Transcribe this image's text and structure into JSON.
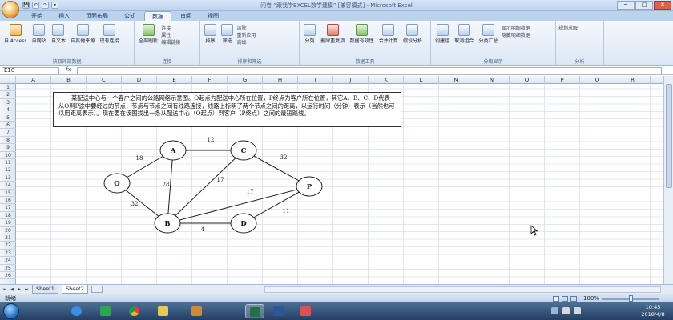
{
  "window": {
    "title": "问卷 “跟我学EXCEL数学建模” [兼容模式] - Microsoft Excel",
    "buttons": [
      "─",
      "□",
      "✕"
    ]
  },
  "quick_access": [
    "💾",
    "↶",
    "↷",
    "▾"
  ],
  "tabs": [
    {
      "label": "开始",
      "active": false
    },
    {
      "label": "插入",
      "active": false
    },
    {
      "label": "页面布局",
      "active": false
    },
    {
      "label": "公式",
      "active": false
    },
    {
      "label": "数据",
      "active": true
    },
    {
      "label": "审阅",
      "active": false
    },
    {
      "label": "视图",
      "active": false
    }
  ],
  "ribbon": {
    "external": {
      "name": "获取外部数据",
      "buttons": [
        "自 Access",
        "自网站",
        "自文本",
        "自其他来源",
        "现有连接"
      ]
    },
    "connections": {
      "name": "连接",
      "refresh": "全部刷新",
      "items": [
        "连接",
        "属性",
        "编辑链接"
      ]
    },
    "sort_filter": {
      "name": "排序和筛选",
      "sort": "排序",
      "filter": "筛选",
      "items": [
        "清除",
        "重新应用",
        "高级"
      ]
    },
    "data_tools": {
      "name": "数据工具",
      "buttons": [
        "分列",
        "删除重复项",
        "数据有效性",
        "合并计算",
        "假设分析"
      ]
    },
    "outline": {
      "name": "分级显示",
      "buttons": [
        "创建组",
        "取消组合",
        "分类汇总"
      ],
      "items": [
        "显示明细数据",
        "隐藏明细数据"
      ]
    },
    "analysis": {
      "name": "分析",
      "buttons": [
        "规划求解"
      ]
    }
  },
  "formula_bar": {
    "name_box": "E10",
    "fx": "fx",
    "formula": ""
  },
  "columns": [
    "A",
    "B",
    "C",
    "D",
    "E",
    "F",
    "G",
    "H",
    "I",
    "J",
    "K",
    "L",
    "M",
    "N",
    "O",
    "P",
    "Q",
    "R"
  ],
  "rows": [
    "1",
    "2",
    "3",
    "4",
    "5",
    "6",
    "7",
    "8",
    "9",
    "10",
    "11",
    "12",
    "13",
    "14",
    "15",
    "16",
    "17",
    "18",
    "19",
    "20",
    "21",
    "22",
    "23",
    "24",
    "25",
    "26"
  ],
  "problem_text": "某配送中心与一个客户之间的公路网络示意图。O起点为配送中心所在位置，P终点为客户所在位置，其它A、B、C、D代表从O到P途中要经过的节点，节点与节点之间有线路连接，线路上标明了两个节点之间的距离，以运行时间（分钟）表示（当然也可以用距离表示）。现在要在该图找出一条从配送中心（O起点）到客户（P终点）之间的最短路线。",
  "network": {
    "nodes": [
      "O",
      "A",
      "B",
      "C",
      "D",
      "P"
    ],
    "edges": [
      {
        "from": "O",
        "to": "A",
        "weight": "18"
      },
      {
        "from": "O",
        "to": "B",
        "weight": "32"
      },
      {
        "from": "A",
        "to": "B",
        "weight": "28"
      },
      {
        "from": "A",
        "to": "C",
        "weight": "12"
      },
      {
        "from": "B",
        "to": "C",
        "weight": "17"
      },
      {
        "from": "B",
        "to": "P",
        "weight": "17"
      },
      {
        "from": "B",
        "to": "D",
        "weight": "4"
      },
      {
        "from": "C",
        "to": "P",
        "weight": "32"
      },
      {
        "from": "D",
        "to": "P",
        "weight": "11"
      }
    ]
  },
  "sheets": [
    {
      "label": "Sheet1",
      "active": false
    },
    {
      "label": "Sheet2",
      "active": true
    }
  ],
  "status": {
    "text": "就绪",
    "zoom": "100%"
  },
  "taskbar": {
    "apps": [
      "ie-icon",
      "media-icon",
      "chrome-icon",
      "folder-icon",
      "player-icon",
      "excel-icon",
      "word-icon",
      "paint-icon"
    ],
    "time": "10:45",
    "date": "2018/4/8"
  }
}
